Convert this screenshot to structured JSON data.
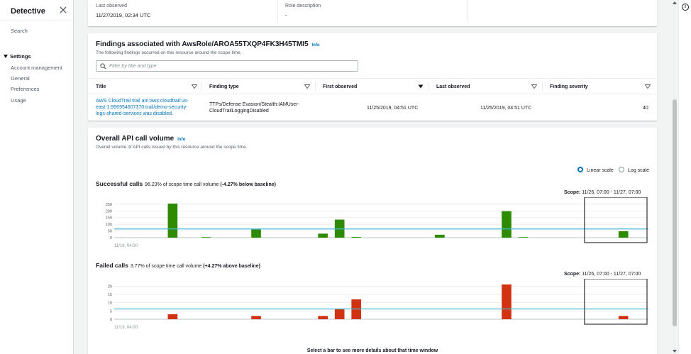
{
  "sidebar": {
    "title": "Detective",
    "search": "Search",
    "settings_heading": "Settings",
    "items": [
      {
        "label": "Account management"
      },
      {
        "label": "General"
      },
      {
        "label": "Preferences"
      },
      {
        "label": "Usage"
      }
    ]
  },
  "summary": {
    "last_observed_label": "Last observed",
    "last_observed_value": "11/27/2019, 02:34 UTC",
    "role_description_label": "Role description",
    "role_description_value": "-"
  },
  "findings": {
    "title": "Findings associated with AwsRole/AROA55TXQP4FK3H45TMI5",
    "info": "Info",
    "description": "The following findings occurred on this resource around the scope time.",
    "filter_placeholder": "Filter by title and type",
    "columns": [
      "Title",
      "Finding type",
      "First observed",
      "Last observed",
      "Finding severity"
    ],
    "rows": [
      {
        "title_lines": [
          "AWS CloudTrail trail arn:aws:cloudtrail:us-",
          "east-1:956954607370:trail/demo-security-",
          "logs-shared-services was disabled."
        ],
        "type_lines": [
          "TTPs/Defense Evasion/Stealth:IAMUser-",
          "CloudTrailLoggingDisabled"
        ],
        "first_observed": "11/25/2019, 04:51 UTC",
        "last_observed": "11/25/2019, 04:51 UTC",
        "severity": "40"
      }
    ]
  },
  "api": {
    "title": "Overall API call volume",
    "info": "Info",
    "description": "Overall volume of API calls issued by this resource around the scope time.",
    "scale_options": [
      "Linear scale",
      "Log scale"
    ],
    "selected_scale": "Linear scale",
    "footer_hint": "Select a bar to see more details about that time window"
  },
  "chart_data": [
    {
      "type": "bar",
      "title": "Successful calls",
      "subtitle": "96.23% of scope time call volume",
      "subtitle_bold": "(-4.27% below baseline)",
      "scope_prefix": "Scope:",
      "scope_range": "11/26, 07:00 - 11/27, 07:00",
      "x_start_label": "11/19, 04:00",
      "y_ticks": [
        "250",
        "200",
        "150",
        "100",
        "50",
        "0"
      ],
      "ylim": [
        0,
        260
      ],
      "baseline": 65,
      "bar_count": 32,
      "bars": [
        {
          "i": 3,
          "value": 255
        },
        {
          "i": 5,
          "value": 2
        },
        {
          "i": 8,
          "value": 62
        },
        {
          "i": 12,
          "value": 30
        },
        {
          "i": 13,
          "value": 135
        },
        {
          "i": 14,
          "value": 5
        },
        {
          "i": 19,
          "value": 22
        },
        {
          "i": 23,
          "value": 198
        },
        {
          "i": 24,
          "value": 3
        },
        {
          "i": 30,
          "value": 48
        }
      ],
      "scope_start": 28,
      "scope_end": 31,
      "color": "#2e8b00"
    },
    {
      "type": "bar",
      "title": "Failed calls",
      "subtitle": "3.77% of scope time call volume",
      "subtitle_bold": "(+4.27% above baseline)",
      "scope_prefix": "Scope:",
      "scope_range": "11/26, 07:00 - 11/27, 07:00",
      "x_start_label": "11/19, 04:00",
      "y_ticks": [
        "20",
        "15",
        "10",
        "5",
        "0"
      ],
      "ylim": [
        0,
        21
      ],
      "baseline": 6.2,
      "bar_count": 32,
      "bars": [
        {
          "i": 3,
          "value": 3
        },
        {
          "i": 8,
          "value": 2
        },
        {
          "i": 12,
          "value": 2
        },
        {
          "i": 13,
          "value": 6
        },
        {
          "i": 14,
          "value": 12
        },
        {
          "i": 23,
          "value": 21
        },
        {
          "i": 30,
          "value": 2
        }
      ],
      "scope_start": 28,
      "scope_end": 31,
      "color": "#d13212"
    }
  ],
  "colors": {
    "accent": "#0073bb",
    "baseline": "#44b9d6",
    "success": "#2e8b00",
    "failure": "#d13212"
  }
}
